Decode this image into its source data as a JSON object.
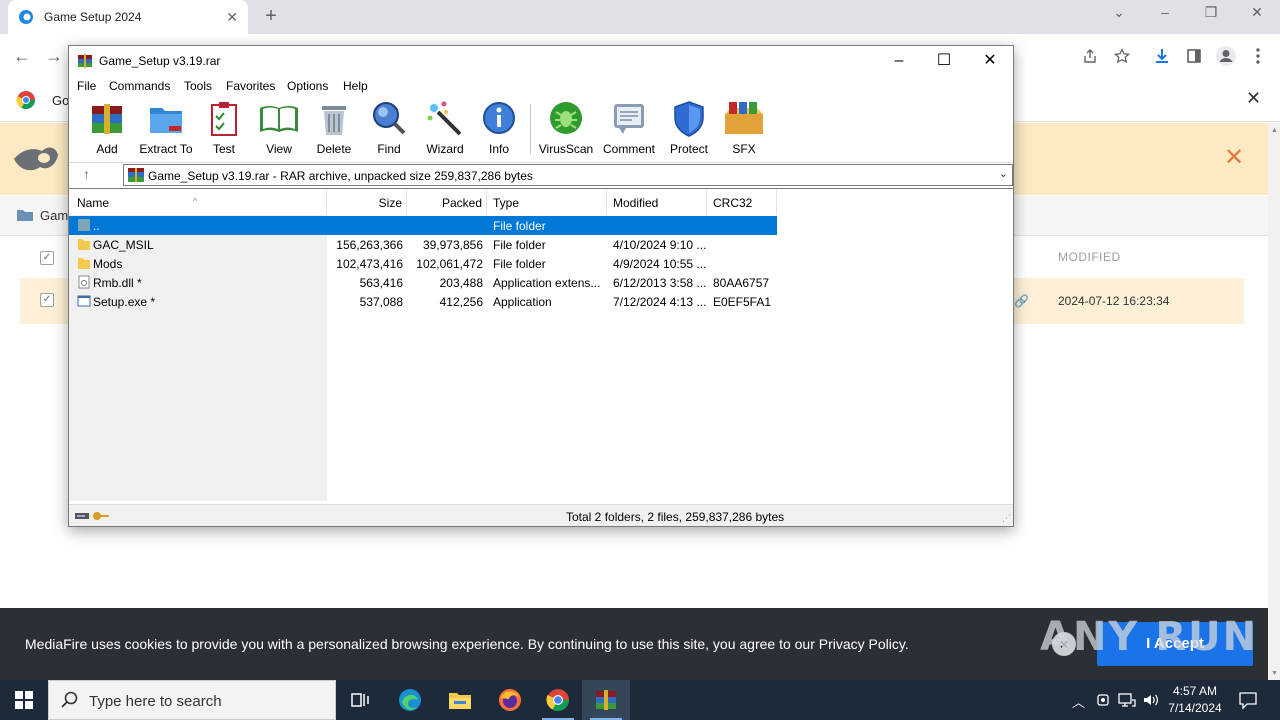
{
  "browser": {
    "tab_title": "Game Setup 2024",
    "bookmark_text": "Go",
    "crumb_text": "Gam",
    "modified_header": "MODIFIED",
    "row_date": "2024-07-12 16:23:34"
  },
  "cookie": {
    "text": "MediaFire uses cookies to provide you with a personalized browsing experience. By continuing to use this site, you agree to our Privacy Policy.",
    "accept_label": "I Accept",
    "close_label": "×"
  },
  "watermark": "ANY RUN",
  "winrar": {
    "title": "Game_Setup v3.19.rar",
    "menu": [
      "File",
      "Commands",
      "Tools",
      "Favorites",
      "Options",
      "Help"
    ],
    "tools": [
      "Add",
      "Extract To",
      "Test",
      "View",
      "Delete",
      "Find",
      "Wizard",
      "Info",
      "VirusScan",
      "Comment",
      "Protect",
      "SFX"
    ],
    "path": "Game_Setup v3.19.rar - RAR archive, unpacked size 259,837,286 bytes",
    "columns": [
      "Name",
      "Size",
      "Packed",
      "Type",
      "Modified",
      "CRC32"
    ],
    "rows": [
      {
        "name": "..",
        "size": "",
        "packed": "",
        "type": "File folder",
        "modified": "",
        "crc": ""
      },
      {
        "name": "GAC_MSIL",
        "size": "156,263,366",
        "packed": "39,973,856",
        "type": "File folder",
        "modified": "4/10/2024 9:10 ...",
        "crc": ""
      },
      {
        "name": "Mods",
        "size": "102,473,416",
        "packed": "102,061,472",
        "type": "File folder",
        "modified": "4/9/2024 10:55 ...",
        "crc": ""
      },
      {
        "name": "Rmb.dll *",
        "size": "563,416",
        "packed": "203,488",
        "type": "Application extens...",
        "modified": "6/12/2013 3:58 ...",
        "crc": "80AA6757"
      },
      {
        "name": "Setup.exe *",
        "size": "537,088",
        "packed": "412,256",
        "type": "Application",
        "modified": "7/12/2024 4:13 ...",
        "crc": "E0EF5FA1"
      }
    ],
    "status": "Total 2 folders, 2 files, 259,837,286 bytes"
  },
  "taskbar": {
    "search_placeholder": "Type here to search",
    "time": "4:57 AM",
    "date": "7/14/2024"
  }
}
